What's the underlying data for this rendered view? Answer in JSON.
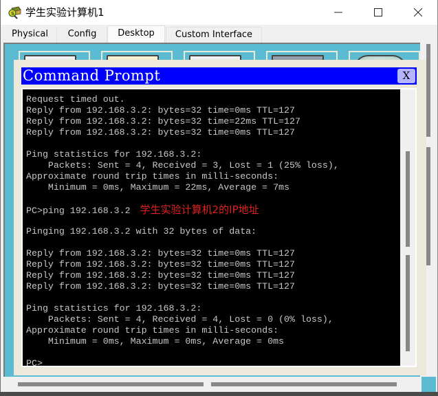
{
  "window": {
    "title": "学生实验计算机1",
    "icon": "packet-tracer-pc-icon",
    "controls": {
      "minimize": "—",
      "maximize": "☐",
      "close": "✕"
    }
  },
  "tabs": [
    {
      "label": "Physical",
      "active": false
    },
    {
      "label": "Config",
      "active": false
    },
    {
      "label": "Desktop",
      "active": true
    },
    {
      "label": "Custom Interface",
      "active": false
    }
  ],
  "command_prompt": {
    "title": "Command Prompt",
    "close_label": "X",
    "lines": [
      "Request timed out.",
      "Reply from 192.168.3.2: bytes=32 time=0ms TTL=127",
      "Reply from 192.168.3.2: bytes=32 time=22ms TTL=127",
      "Reply from 192.168.3.2: bytes=32 time=0ms TTL=127",
      "",
      "Ping statistics for 192.168.3.2:",
      "    Packets: Sent = 4, Received = 3, Lost = 1 (25% loss),",
      "Approximate round trip times in milli-seconds:",
      "    Minimum = 0ms, Maximum = 22ms, Average = 7ms",
      "",
      "PC>ping 192.168.3.2",
      "",
      "Pinging 192.168.3.2 with 32 bytes of data:",
      "",
      "Reply from 192.168.3.2: bytes=32 time=0ms TTL=127",
      "Reply from 192.168.3.2: bytes=32 time=0ms TTL=127",
      "Reply from 192.168.3.2: bytes=32 time=0ms TTL=127",
      "Reply from 192.168.3.2: bytes=32 time=0ms TTL=127",
      "",
      "Ping statistics for 192.168.3.2:",
      "    Packets: Sent = 4, Received = 4, Lost = 0 (0% loss),",
      "Approximate round trip times in milli-seconds:",
      "    Minimum = 0ms, Maximum = 0ms, Average = 0ms",
      "",
      "PC>"
    ],
    "annotation": "学生实验计算机2的IP地址"
  },
  "colors": {
    "cmd_header": "#0000ff",
    "terminal_bg": "#000000",
    "terminal_text": "#c8c8c8",
    "annotation": "#e0201c",
    "desktop_bg": "#5bbbd2"
  }
}
